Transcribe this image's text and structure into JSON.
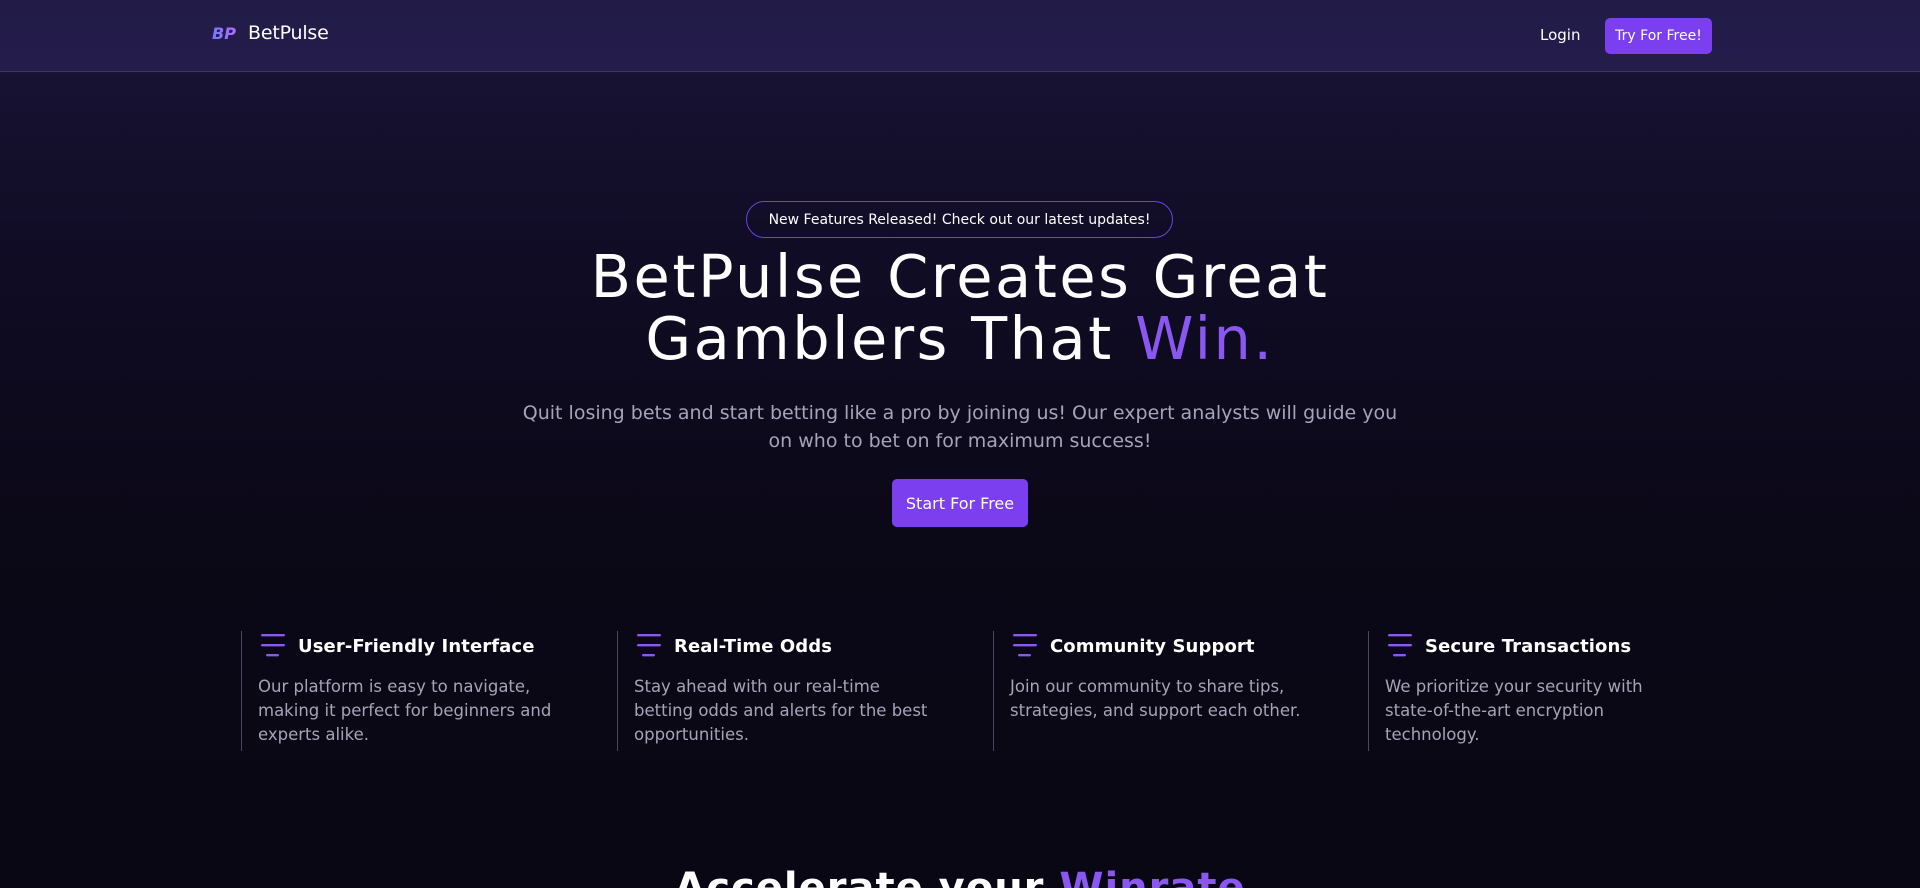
{
  "brand": {
    "logo_text": "BP",
    "name": "BetPulse"
  },
  "nav": {
    "login_label": "Login",
    "cta_label": "Try For Free!"
  },
  "hero": {
    "announcement": "New Features Released! Check out our latest updates!",
    "title_line1": "BetPulse Creates Great",
    "title_line2_prefix": "Gamblers That ",
    "title_line2_accent": "Win.",
    "subtitle": "Quit losing bets and start betting like a pro by joining us! Our expert analysts will guide you on who to bet on for maximum success!",
    "cta_label": "Start For Free"
  },
  "features": [
    {
      "title": "User-Friendly Interface",
      "description": "Our platform is easy to navigate, making it perfect for beginners and experts alike.",
      "icon": "menu-lines-icon"
    },
    {
      "title": "Real-Time Odds",
      "description": "Stay ahead with our real-time betting odds and alerts for the best opportunities.",
      "icon": "menu-lines-icon"
    },
    {
      "title": "Community Support",
      "description": "Join our community to share tips, strategies, and support each other.",
      "icon": "menu-lines-icon"
    },
    {
      "title": "Secure Transactions",
      "description": "We prioritize your security with state-of-the-art encryption technology.",
      "icon": "menu-lines-icon"
    }
  ],
  "next_section": {
    "title_prefix": "Accelerate your ",
    "title_accent": "Winrate"
  },
  "colors": {
    "accent": "#7b3ff0",
    "accent_text": "#8a58f0",
    "muted_text": "#a7a3b8",
    "nav_bg": "#241d4b",
    "page_bg": "#0b0816"
  }
}
